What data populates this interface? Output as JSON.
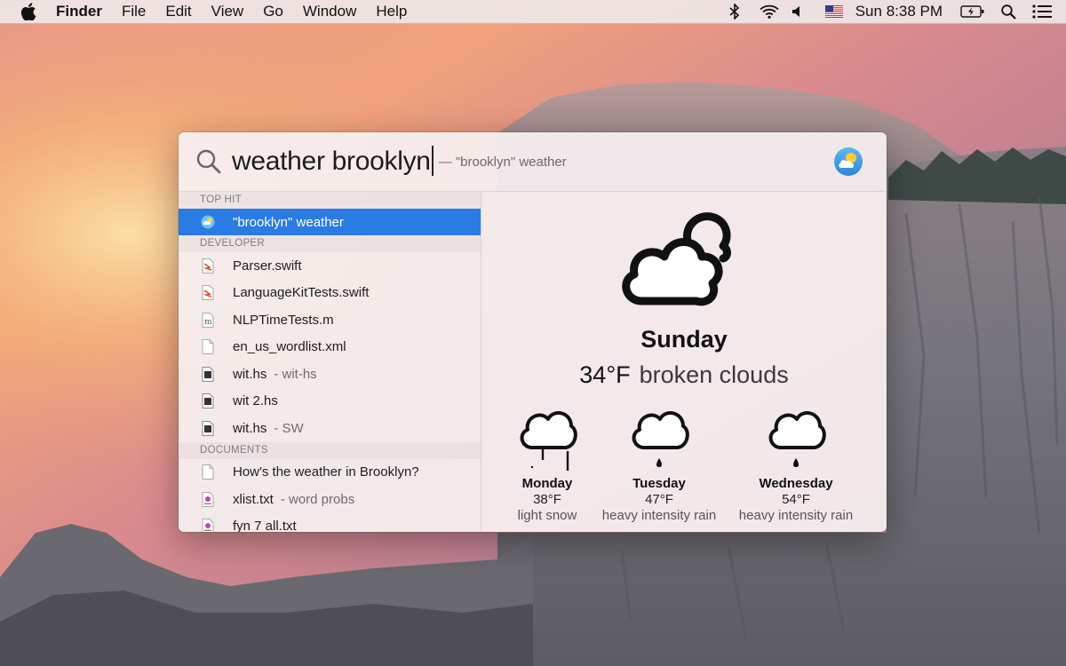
{
  "menubar": {
    "app_name": "Finder",
    "menus": [
      "File",
      "Edit",
      "View",
      "Go",
      "Window",
      "Help"
    ],
    "clock": "Sun 8:38 PM",
    "status_icons": [
      "bluetooth-icon",
      "wifi-icon",
      "volume-icon",
      "us-flag-input-icon",
      "battery-charging-icon",
      "spotlight-icon",
      "notification-center-icon"
    ]
  },
  "spotlight": {
    "query": "weather brooklyn",
    "completion": "— \"brooklyn\" weather",
    "sections": [
      {
        "header": "TOP HIT",
        "items": [
          {
            "label": "\"brooklyn\" weather",
            "sub": "",
            "icon": "weather-app-icon",
            "selected": true
          }
        ]
      },
      {
        "header": "DEVELOPER",
        "items": [
          {
            "label": "Parser.swift",
            "sub": "",
            "icon": "swift-file-icon"
          },
          {
            "label": "LanguageKitTests.swift",
            "sub": "",
            "icon": "swift-file-icon"
          },
          {
            "label": "NLPTimeTests.m",
            "sub": "",
            "icon": "objc-file-icon"
          },
          {
            "label": "en_us_wordlist.xml",
            "sub": "",
            "icon": "blank-file-icon"
          },
          {
            "label": "wit.hs",
            "sub": "- wit-hs",
            "icon": "exec-file-icon"
          },
          {
            "label": "wit 2.hs",
            "sub": "",
            "icon": "exec-file-icon"
          },
          {
            "label": "wit.hs",
            "sub": "- SW",
            "icon": "exec-file-icon"
          }
        ]
      },
      {
        "header": "DOCUMENTS",
        "items": [
          {
            "label": "How's the weather in Brooklyn?",
            "sub": "",
            "icon": "blank-file-icon"
          },
          {
            "label": "xlist.txt",
            "sub": "- word probs",
            "icon": "text-file-icon"
          },
          {
            "label": "fyn 7 all.txt",
            "sub": "",
            "icon": "text-file-icon"
          }
        ]
      }
    ]
  },
  "weather": {
    "today": {
      "day": "Sunday",
      "temp": "34°F",
      "condition": "broken clouds",
      "icon": "broken-clouds-icon"
    },
    "forecast": [
      {
        "day": "Monday",
        "temp": "38°F",
        "condition": "light snow",
        "icon": "snow-cloud-icon"
      },
      {
        "day": "Tuesday",
        "temp": "47°F",
        "condition": "heavy intensity rain",
        "icon": "rain-cloud-icon"
      },
      {
        "day": "Wednesday",
        "temp": "54°F",
        "condition": "heavy intensity rain",
        "icon": "rain-cloud-icon"
      }
    ]
  },
  "colors": {
    "selection": "#2a7be4",
    "panel": "#f6f0f1"
  }
}
